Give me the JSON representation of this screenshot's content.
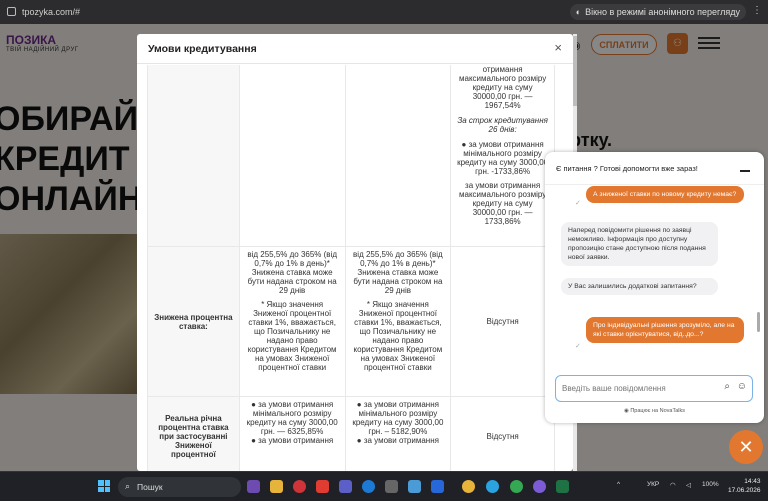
{
  "browser": {
    "url": "tpozyka.com/#",
    "incognito_label": "Вікно в режимі анонімного перегляду"
  },
  "site": {
    "logo_text": "ПОЗИКА",
    "logo_tagline": "ТВІЙ НАДІЙНИЙ ДРУГ",
    "hero_lines": [
      "ОБИРАЙ",
      "КРЕДИТ",
      "ОНЛАЙН"
    ],
    "hero_right": "ртку.",
    "pay_button": "СПЛАТИТИ"
  },
  "modal": {
    "title": "Умови кредитування",
    "close": "×",
    "row1": {
      "c3_a": "отримання максимального розміру кредиту на суму 30000,00 грн. — 1967,54%",
      "c3_b": "За строк кредитування 26 днів:",
      "c3_c": "● за умови отримання мінімального розміру кредиту на суму 3000,00 грн. -1733,86%",
      "c3_d": "за умови отримання максимального розміру кредиту на суму 30000,00 грн. — 1733,86%"
    },
    "row2": {
      "label": "Знижена процентна ставка:",
      "c1_a": "від 255,5% до 365% (від 0,7% до 1% в день)* Знижена ставка може бути надана строком на 29 днів",
      "c1_b": "* Якщо значення Зниженої процентної ставки 1%, вважається, що Позичальнику не надано право користування Кредитом на умовах Зниженої процентної ставки",
      "c2_a": "від 255,5% до 365% (від 0,7% до 1% в день)* Знижена ставка може бути надана строком на 29 днів",
      "c2_b": "* Якщо значення Зниженої процентної ставки 1%, вважається, що Позичальнику не надано право користування Кредитом на умовах Зниженої процентної ставки",
      "c3": "Відсутня"
    },
    "row3": {
      "label": "Реальна річна процентна ставка при застосуванні Зниженої процентної",
      "c1": "● за умови отримання мінімального розміру кредиту на суму 3000,00 грн. — 6325,85%",
      "c1_more": "● за умови отримання",
      "c2": "● за умови отримання мінімального розміру кредиту на суму 3000,00 грн. – 5182,90%",
      "c2_more": "● за умови отримання",
      "c3": "Відсутня"
    }
  },
  "chat": {
    "header": "Є питання ? Готові допомогти вже зараз!",
    "messages": [
      {
        "from": "user",
        "text": "А зниженої ставки по новому кредиту немає?"
      },
      {
        "from": "bot",
        "text": "Наперед повідомити рішення по заявці неможливо. Інформація про доступну пропозицію стане доступною після подання нової заявки."
      },
      {
        "from": "bot",
        "text": "У Вас залишились додаткові запитання?"
      },
      {
        "from": "user",
        "text": "Про індивідуальні рішення зрозуміло, але на які ставки орієнтуватися, від..до...?"
      }
    ],
    "input_placeholder": "Введіть ваше повідомлення",
    "powered": "Працює на NovaTalks"
  },
  "taskbar": {
    "search_label": "Пошук",
    "lang": "УКР",
    "battery": "100%",
    "time": "14:43",
    "date": "17.06.2026"
  },
  "colors": {
    "accent": "#e2772f",
    "brand_purple": "#6d2b8a",
    "input_border": "#7ab2ea"
  }
}
